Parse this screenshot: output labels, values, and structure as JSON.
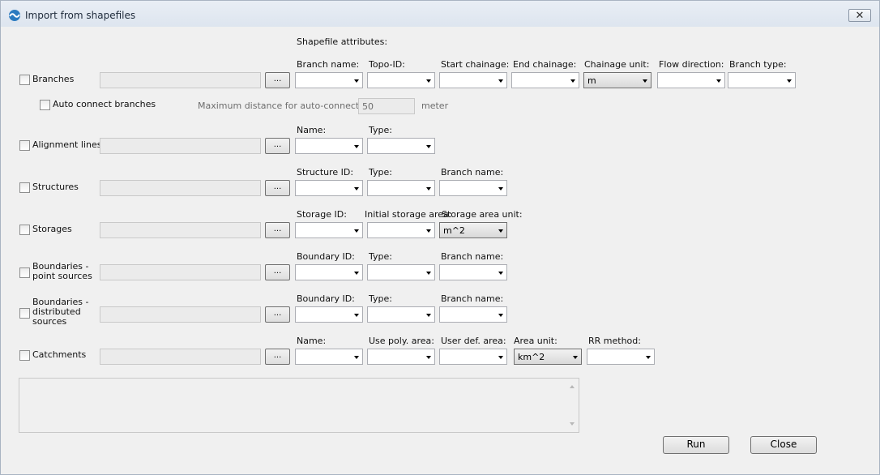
{
  "window": {
    "title": "Import from shapefiles",
    "close_glyph": "✕"
  },
  "header": {
    "shapefile_attributes": "Shapefile attributes:"
  },
  "browse_label": "...",
  "branches": {
    "checkbox_label": "Branches",
    "fields": {
      "branch_name": "Branch name:",
      "topo_id": "Topo-ID:",
      "start_chainage": "Start chainage:",
      "end_chainage": "End chainage:",
      "chainage_unit": "Chainage unit:",
      "flow_direction": "Flow direction:",
      "branch_type": "Branch type:"
    },
    "chainage_unit_value": "m",
    "auto_connect_label": "Auto connect branches",
    "max_distance_label": "Maximum distance for auto-connection:",
    "max_distance_value": "50",
    "max_distance_unit": "meter"
  },
  "alignment_lines": {
    "checkbox_label": "Alignment lines",
    "fields": {
      "name": "Name:",
      "type": "Type:"
    }
  },
  "structures": {
    "checkbox_label": "Structures",
    "fields": {
      "structure_id": "Structure ID:",
      "type": "Type:",
      "branch_name": "Branch name:"
    }
  },
  "storages": {
    "checkbox_label": "Storages",
    "fields": {
      "storage_id": "Storage ID:",
      "initial_storage_area": "Initial storage area:",
      "storage_area_unit": "Storage area unit:"
    },
    "storage_area_unit_value": "m^2"
  },
  "boundaries_point": {
    "checkbox_label": "Boundaries - point sources",
    "fields": {
      "boundary_id": "Boundary ID:",
      "type": "Type:",
      "branch_name": "Branch name:"
    }
  },
  "boundaries_distributed": {
    "checkbox_label": "Boundaries - distributed sources",
    "fields": {
      "boundary_id": "Boundary ID:",
      "type": "Type:",
      "branch_name": "Branch name:"
    }
  },
  "catchments": {
    "checkbox_label": "Catchments",
    "fields": {
      "name": "Name:",
      "use_poly_area": "Use poly. area:",
      "user_def_area": "User def. area:",
      "area_unit": "Area unit:",
      "rr_method": "RR method:"
    },
    "area_unit_value": "km^2"
  },
  "buttons": {
    "run": "Run",
    "close": "Close"
  }
}
